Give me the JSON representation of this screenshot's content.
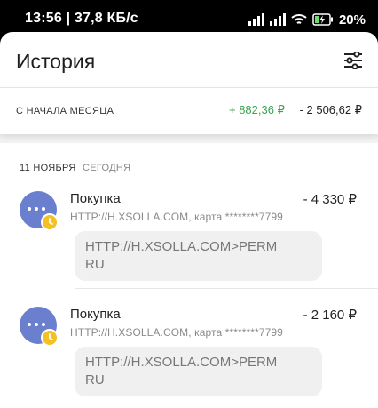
{
  "status_bar": {
    "time_speed": "13:56 | 37,8 КБ/с",
    "battery": "20%"
  },
  "header": {
    "title": "История"
  },
  "summary": {
    "label": "С НАЧАЛА МЕСЯЦА",
    "income": "+ 882,36 ₽",
    "expense": "- 2 506,62 ₽"
  },
  "date_group": {
    "date": "11 НОЯБРЯ",
    "relative": "СЕГОДНЯ"
  },
  "transactions": [
    {
      "name": "Покупка",
      "amount": "- 4 330 ₽",
      "details": "HTTP://H.XSOLLA.COM, карта ********7799",
      "comment": "HTTP://H.XSOLLA.COM>PERM RU"
    },
    {
      "name": "Покупка",
      "amount": "- 2 160 ₽",
      "details": "HTTP://H.XSOLLA.COM, карта ********7799",
      "comment": "HTTP://H.XSOLLA.COM>PERM RU"
    }
  ],
  "colors": {
    "income": "#36a64f",
    "avatar": "#6b7fcf",
    "pending_badge": "#f5c023"
  },
  "icons": [
    "signal-icon",
    "wifi-icon",
    "battery-charging-icon",
    "filter-sliders-icon",
    "more-dots-icon",
    "clock-icon"
  ]
}
